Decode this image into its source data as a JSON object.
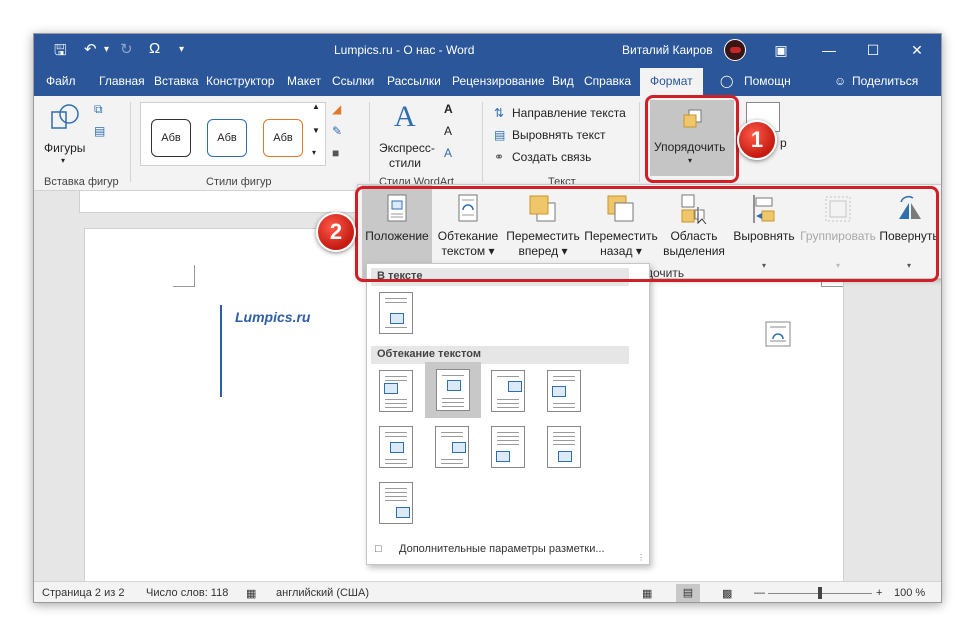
{
  "titlebar": {
    "title": "Lumpics.ru - О нас  -  Word",
    "user": "Виталий Каиров",
    "qa_omega": "Ω"
  },
  "tabs": [
    "Файл",
    "Главная",
    "Вставка",
    "Конструктор",
    "Макет",
    "Ссылки",
    "Рассылки",
    "Рецензирование",
    "Вид",
    "Справка",
    "Формат"
  ],
  "tab_help": "Помощн",
  "tab_share": "Поделиться",
  "ribbon": {
    "shapes_label": "Фигуры",
    "insert_group": "Вставка фигур",
    "styles_group": "Стили фигур",
    "swatch_text": "Абв",
    "express_label_1": "Экспресс-",
    "express_label_2": "стили",
    "wordart_group": "Стили WordArt",
    "text_direction": "Направление текста",
    "align_text": "Выровнять текст",
    "create_link": "Создать связь",
    "text_group": "Текст",
    "arrange_label": "Упорядочить",
    "size_partial": "р"
  },
  "arrange_panel": {
    "items": [
      {
        "line1": "Положение",
        "line2": ""
      },
      {
        "line1": "Обтекание",
        "line2": "текстом"
      },
      {
        "line1": "Переместить",
        "line2": "вперед"
      },
      {
        "line1": "Переместить",
        "line2": "назад"
      },
      {
        "line1": "Область",
        "line2": "выделения"
      },
      {
        "line1": "Выровнять",
        "line2": ""
      },
      {
        "line1": "Группировать",
        "line2": ""
      },
      {
        "line1": "Повернуть",
        "line2": ""
      }
    ],
    "group_partial": "дочить"
  },
  "dropdown": {
    "section_inline": "В тексте",
    "section_wrap": "Обтекание текстом",
    "more_options": "Дополнительные параметры разметки..."
  },
  "document": {
    "heading": "Lumpics.ru"
  },
  "statusbar": {
    "page": "Страница 2 из 2",
    "words": "Число слов: 118",
    "language": "английский (США)",
    "zoom": "100 %"
  },
  "callouts": {
    "one": "1",
    "two": "2"
  },
  "colors": {
    "title_bar": "#2b579a",
    "callout_red": "#d01f27"
  }
}
